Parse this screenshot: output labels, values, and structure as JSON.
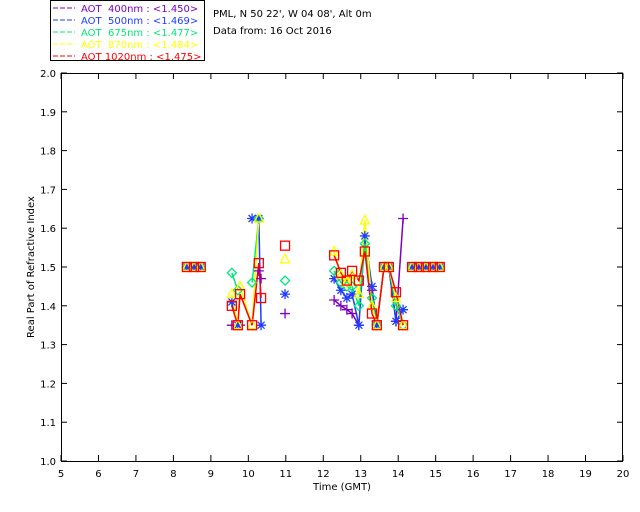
{
  "header": {
    "site_line": "PML, N 50 22', W 04 08', Alt 0m",
    "date_line": "Data from: 16 Oct 2016"
  },
  "chart_data": {
    "type": "scatter",
    "xlabel": "Time (GMT)",
    "ylabel": "Real Part of Refractive Index",
    "xlim": [
      5,
      20
    ],
    "ylim": [
      1.0,
      2.0
    ],
    "xticks": [
      "5",
      "6",
      "7",
      "8",
      "9",
      "10",
      "11",
      "12",
      "13",
      "14",
      "15",
      "16",
      "17",
      "18",
      "19",
      "20"
    ],
    "yticks": [
      "1.0",
      "1.1",
      "1.2",
      "1.3",
      "1.4",
      "1.5",
      "1.6",
      "1.7",
      "1.8",
      "1.9",
      "2.0"
    ],
    "grid": false,
    "legend_placement": "top-left outside",
    "x": [
      8.36,
      8.55,
      8.73,
      9.56,
      9.72,
      9.78,
      10.1,
      10.28,
      10.34,
      10.98,
      12.29,
      12.47,
      12.63,
      12.77,
      12.95,
      13.11,
      13.3,
      13.43,
      13.62,
      13.75,
      13.94,
      14.13,
      14.37,
      14.55,
      14.74,
      14.93,
      15.11
    ],
    "series": [
      {
        "name": "AOT  400nm : <1.450>",
        "color": "#7f00bf",
        "marker": "plus",
        "values": [
          1.5,
          1.5,
          1.5,
          1.35,
          null,
          1.35,
          null,
          1.49,
          1.47,
          1.38,
          1.415,
          1.4,
          1.39,
          1.38,
          1.35,
          null,
          1.44,
          1.35,
          1.5,
          1.5,
          1.36,
          1.625,
          1.5,
          1.5,
          1.5,
          1.5,
          1.5
        ]
      },
      {
        "name": "AOT  500nm : <1.469>",
        "color": "#1e3cff",
        "marker": "asterisk",
        "values": [
          1.5,
          1.5,
          1.5,
          1.41,
          1.35,
          null,
          1.625,
          1.625,
          1.35,
          1.43,
          1.47,
          1.44,
          1.42,
          1.43,
          1.35,
          1.58,
          1.45,
          1.35,
          1.5,
          1.5,
          1.36,
          1.39,
          1.5,
          1.5,
          1.5,
          1.5,
          1.5
        ]
      },
      {
        "name": "AOT  675nm : <1.477>",
        "color": "#00e87a",
        "marker": "diamond",
        "values": [
          1.5,
          1.5,
          1.5,
          1.485,
          1.44,
          null,
          1.46,
          1.625,
          null,
          1.465,
          1.49,
          1.46,
          1.45,
          1.45,
          1.4,
          1.56,
          1.42,
          1.35,
          1.5,
          1.5,
          1.4,
          1.35,
          1.5,
          1.5,
          1.5,
          1.5,
          1.5
        ]
      },
      {
        "name": "AOT  870nm : <1.484>",
        "color": "#ffff00",
        "marker": "triangle",
        "values": [
          1.5,
          1.5,
          1.5,
          1.43,
          1.35,
          1.45,
          1.35,
          1.625,
          null,
          1.52,
          1.54,
          1.48,
          1.46,
          1.48,
          1.43,
          1.62,
          1.4,
          1.35,
          1.5,
          1.5,
          1.42,
          1.35,
          1.5,
          1.5,
          1.5,
          1.5,
          1.5
        ]
      },
      {
        "name": "AOT 1020nm : <1.475>",
        "color": "#ff0000",
        "marker": "square",
        "values": [
          1.5,
          1.5,
          1.5,
          1.4,
          1.35,
          1.43,
          1.35,
          1.51,
          1.42,
          1.555,
          1.53,
          1.485,
          1.465,
          1.49,
          1.465,
          1.54,
          1.38,
          1.35,
          1.5,
          1.5,
          1.435,
          1.35,
          1.5,
          1.5,
          1.5,
          1.5,
          1.5
        ]
      }
    ]
  }
}
